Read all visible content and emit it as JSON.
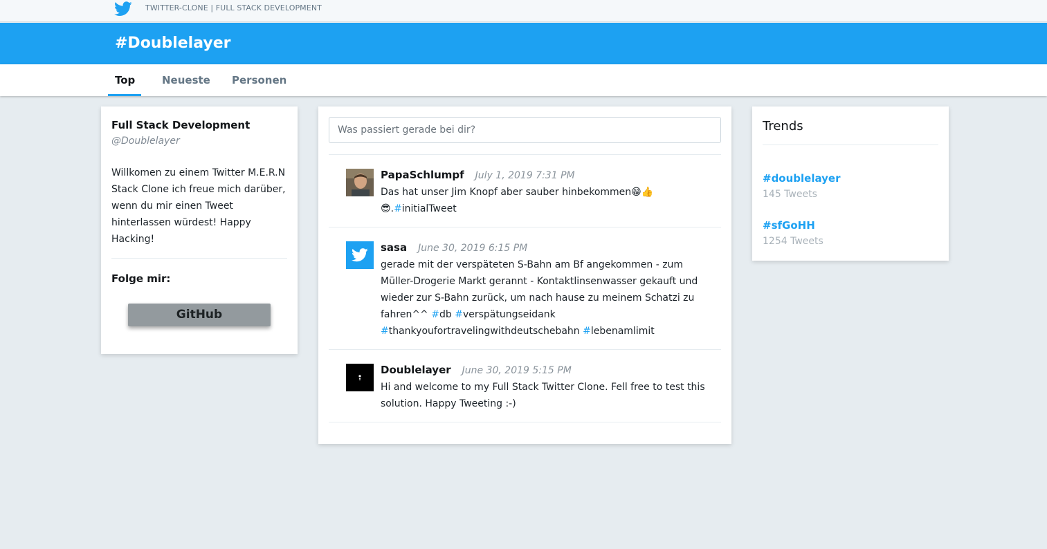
{
  "header": {
    "app_title": "TWITTER-CLONE | FULL STACK DEVELOPMENT",
    "brand_color": "#1da1f2"
  },
  "hero": {
    "hashtag": "#Doublelayer"
  },
  "tabs": [
    {
      "label": "Top",
      "active": true
    },
    {
      "label": "Neueste",
      "active": false
    },
    {
      "label": "Personen",
      "active": false
    }
  ],
  "profile": {
    "name": "Full Stack Development",
    "handle": "@Doublelayer",
    "bio": "Willkomen zu einem Twitter M.E.R.N Stack Clone ich freue mich darüber, wenn du mir einen Tweet hinterlassen würdest! Happy Hacking!",
    "follow_label": "Folge mir:",
    "github_label": "GitHub"
  },
  "composer": {
    "placeholder": "Was passiert gerade bei dir?"
  },
  "tweets": [
    {
      "author": "PapaSchlumpf",
      "date": "July 1, 2019 7:31 PM",
      "avatar": "user-photo",
      "text_1": "Das hat unser Jim Knopf aber sauber hinbekommen",
      "emoji_1": "😁👍",
      "emoji_2": "😎",
      "text_2": ".",
      "hashtag_1": "initialTweet"
    },
    {
      "author": "sasa",
      "date": "June 30, 2019 6:15 PM",
      "avatar": "twitter-bird-icon",
      "text_1": "gerade mit der verspäteten S-Bahn am Bf angekommen - zum Müller-Drogerie Markt gerannt - Kontaktlinsenwasser gekauft und wieder zur S-Bahn zurück, um nach hause zu meinem Schatzi zu fahren^^",
      "hashtag_1": "db",
      "hashtag_2": "verspätungseidank",
      "hashtag_3": "thankyoufortravelingwithdeutschebahn",
      "hashtag_4": "lebenamlimit"
    },
    {
      "author": "Doublelayer",
      "date": "June 30, 2019 5:15 PM",
      "avatar": "doublelayer-logo",
      "text_1": "Hi and welcome to my Full Stack Twitter Clone. Fell free to test this solution. Happy Tweeting :-)"
    }
  ],
  "trends": {
    "title": "Trends",
    "items": [
      {
        "tag": "#doublelayer",
        "count": "145 Tweets"
      },
      {
        "tag": "#sfGoHH",
        "count": "1254 Tweets"
      }
    ]
  }
}
